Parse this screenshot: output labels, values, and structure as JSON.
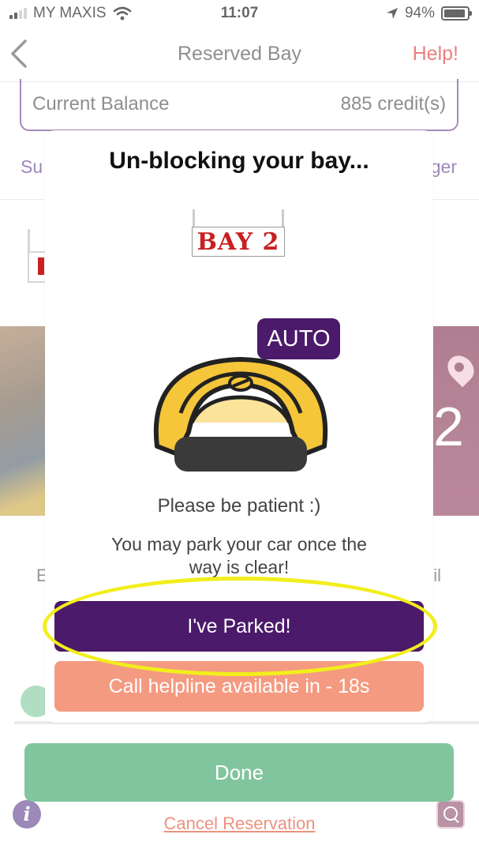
{
  "status_bar": {
    "carrier": "MY MAXIS",
    "time": "11:07",
    "battery": "94%"
  },
  "nav": {
    "title": "Reserved Bay",
    "help": "Help!"
  },
  "background": {
    "balance_label": "Current Balance",
    "balance_value": "885 credit(s)",
    "link_left": "Su",
    "link_right": "ger",
    "bay_number_partial": "2",
    "text_left": "E",
    "text_right": "il",
    "done_label": "Done",
    "cancel_label": "Cancel Reservation"
  },
  "modal": {
    "title": "Un-blocking your bay...",
    "bay_sign": "BAY 2",
    "mode_badge": "AUTO",
    "message_1": "Please be patient :)",
    "message_2": "You may park your car once the way is clear!",
    "parked_button": "I've Parked!",
    "helpline_button": "Call helpline available in - 18s",
    "helpline_countdown_seconds": 18
  },
  "colors": {
    "brand_purple": "#4b1a6a",
    "helpline_salmon": "#f49a80",
    "done_green": "#2e9e5e",
    "help_red": "#e02a2a",
    "highlight_yellow": "#f2ee1c",
    "lock_yellow": "#f5c53a"
  },
  "icons": {
    "back": "chevron-left-icon",
    "wifi": "wifi-icon",
    "location": "location-arrow-icon",
    "battery": "battery-icon",
    "info": "info-icon",
    "zoom": "zoom-in-icon",
    "pin": "map-pin-icon",
    "lock": "parking-lock-icon"
  }
}
